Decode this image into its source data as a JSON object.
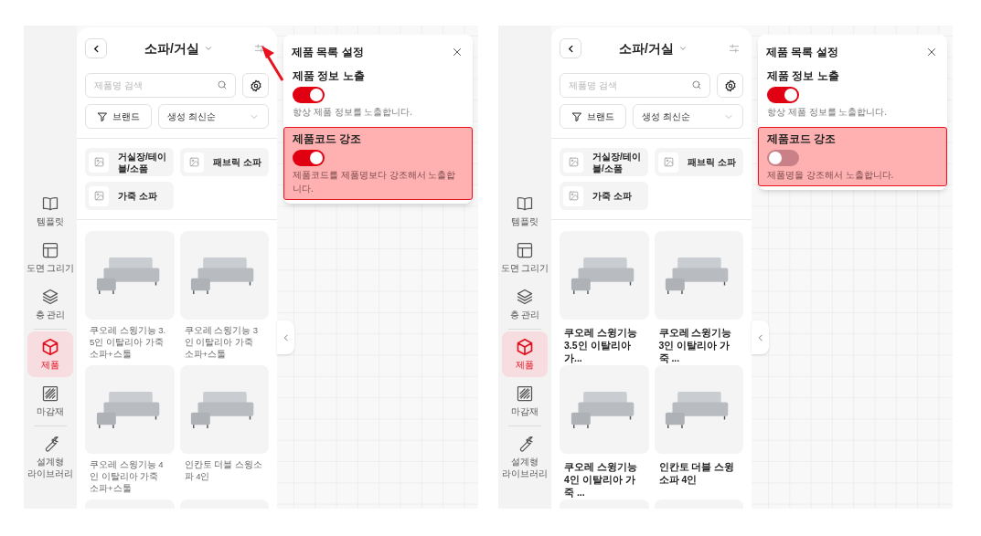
{
  "screens": [
    {
      "pointer_arrow": true,
      "nav": [
        {
          "label": "템플릿",
          "selected": false
        },
        {
          "label": "도면 그리기",
          "selected": false
        },
        {
          "label": "층 관리",
          "selected": false
        },
        {
          "label": "제품",
          "selected": true
        },
        {
          "label": "마감재",
          "selected": false
        },
        {
          "label": "설계형 라이브러리",
          "selected": false
        }
      ],
      "panel": {
        "title": "소파/거실",
        "search_placeholder": "제품명 검색",
        "brand_button": "브랜드",
        "sort": "생성 최신순",
        "categories": [
          "거실장/테이블/소품",
          "패브릭 소파",
          "가죽 소파"
        ],
        "products": [
          {
            "name": "쿠오레 스윙기능 3.5인 이탈리아 가죽 소파+스툴"
          },
          {
            "name": "쿠오레 스윙기능 3인 이탈리아 가죽 소파+스툴"
          },
          {
            "name": "쿠오레 스윙기능 4인 이탈리아 가죽 소파+스툴"
          },
          {
            "name": "인칸토 더블 스윙소파 4인"
          }
        ]
      },
      "settings": {
        "title": "제품 목록 설정",
        "options": [
          {
            "label": "제품 정보 노출",
            "on": true,
            "description": "항상 제품 정보를 노출합니다.",
            "highlighted": false
          },
          {
            "label": "제품코드 강조",
            "on": true,
            "description": "제품코드를 제품명보다 강조해서 노출합니다.",
            "highlighted": true
          }
        ]
      }
    },
    {
      "pointer_arrow": false,
      "nav": [
        {
          "label": "템플릿",
          "selected": false
        },
        {
          "label": "도면 그리기",
          "selected": false
        },
        {
          "label": "층 관리",
          "selected": false
        },
        {
          "label": "제품",
          "selected": true
        },
        {
          "label": "마감재",
          "selected": false
        },
        {
          "label": "설계형 라이브러리",
          "selected": false
        }
      ],
      "panel": {
        "title": "소파/거실",
        "search_placeholder": "제품명 검색",
        "brand_button": "브랜드",
        "sort": "생성 최신순",
        "categories": [
          "거실장/테이블/소품",
          "패브릭 소파",
          "가죽 소파"
        ],
        "products": [
          {
            "name": "쿠오레 스윙기능 3.5인 이탈리아 가..."
          },
          {
            "name": "쿠오레 스윙기능 3인 이탈리아 가죽 ..."
          },
          {
            "name": "쿠오레 스윙기능 4인 이탈리아 가죽 ..."
          },
          {
            "name": "인칸토 더블 스윙소파 4인"
          }
        ]
      },
      "settings": {
        "title": "제품 목록 설정",
        "options": [
          {
            "label": "제품 정보 노출",
            "on": true,
            "description": "항상 제품 정보를 노출합니다.",
            "highlighted": false
          },
          {
            "label": "제품코드 강조",
            "on": false,
            "description": "제품명을 강조해서 노출합니다.",
            "highlighted": true
          }
        ]
      }
    }
  ]
}
